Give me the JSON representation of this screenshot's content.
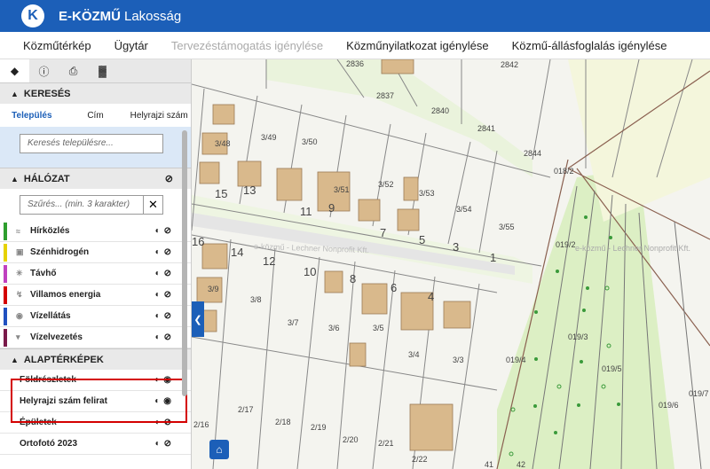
{
  "header": {
    "logo_letter": "K",
    "brand_bold": "E-KÖZMŰ",
    "brand_light": "Lakosság"
  },
  "menu": {
    "items": [
      {
        "label": "Közműtérkép",
        "disabled": false
      },
      {
        "label": "Ügytár",
        "disabled": false
      },
      {
        "label": "Tervezéstámogatás igénylése",
        "disabled": true
      },
      {
        "label": "Közműnyilatkozat igénylése",
        "disabled": false
      },
      {
        "label": "Közmű-állásfoglalás igénylése",
        "disabled": false
      }
    ]
  },
  "toolbar": {
    "icons": [
      "layers-icon",
      "info-icon",
      "print-icon",
      "measure-icon"
    ]
  },
  "search_section": {
    "title": "KERESÉS",
    "tabs": [
      "Település",
      "Cím",
      "Helyrajzi szám"
    ],
    "active_tab": "Település",
    "placeholder": "Keresés településre..."
  },
  "network_section": {
    "title": "HÁLÓZAT",
    "filter_placeholder": "Szűrés... (min. 3 karakter)",
    "clear_label": "✕",
    "layers": [
      {
        "label": "Hírközlés",
        "color": "#2e9e2e"
      },
      {
        "label": "Szénhidrogén",
        "color": "#e6d200"
      },
      {
        "label": "Távhő",
        "color": "#c040c0"
      },
      {
        "label": "Villamos energia",
        "color": "#d40000"
      },
      {
        "label": "Vízellátás",
        "color": "#2050c0"
      },
      {
        "label": "Vízelvezetés",
        "color": "#7a1a4a"
      }
    ]
  },
  "base_section": {
    "title": "ALAPTÉRKÉPEK",
    "layers": [
      {
        "label": "Földrészletek",
        "visible": true
      },
      {
        "label": "Helyrajzi szám felirat",
        "visible": true
      },
      {
        "label": "Épületek",
        "visible": false
      },
      {
        "label": "Ortofotó 2023",
        "visible": false
      }
    ]
  },
  "map": {
    "parcel_labels": [
      "2836",
      "2842",
      "2837",
      "2840",
      "2841",
      "2844",
      "018/2",
      "3/48",
      "3/49",
      "3/50",
      "3/51",
      "3/52",
      "3/53",
      "3/54",
      "3/55",
      "15",
      "13",
      "11",
      "9",
      "7",
      "5",
      "3",
      "1",
      "16",
      "14",
      "12",
      "10",
      "8",
      "6",
      "4",
      "3/9",
      "3/8",
      "3/7",
      "3/6",
      "3/5",
      "3/4",
      "3/3",
      "019/2",
      "019/3",
      "019/4",
      "019/5",
      "019/6",
      "019/7",
      "2/16",
      "2/17",
      "2/18",
      "2/19",
      "2/20",
      "2/21",
      "2/22",
      "41",
      "42"
    ],
    "watermark": "e-közmű - Lechner Nonprofit Kft."
  }
}
